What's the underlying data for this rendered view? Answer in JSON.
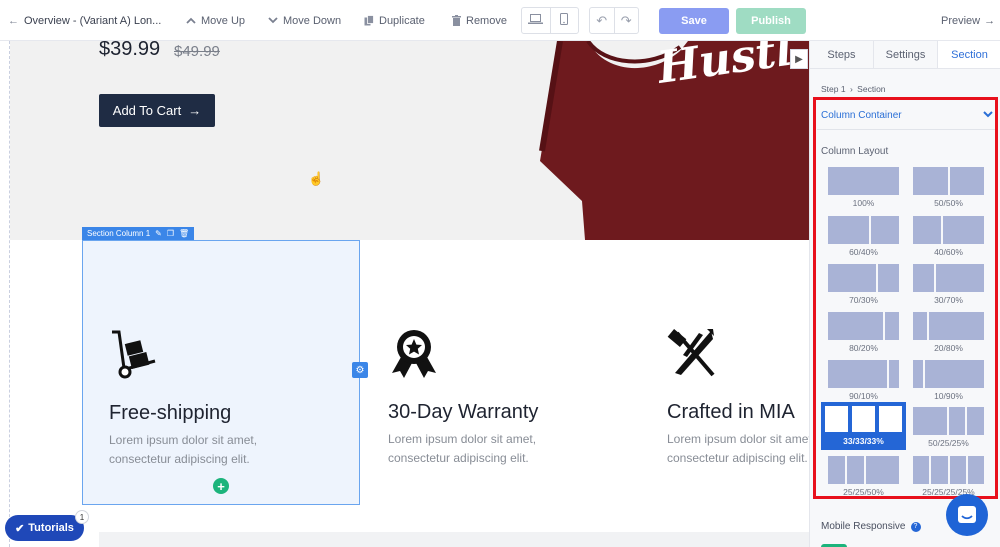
{
  "toolbar": {
    "overview_label": "Overview - (Variant A) Lon...",
    "move_up": "Move Up",
    "move_down": "Move Down",
    "duplicate": "Duplicate",
    "remove": "Remove",
    "save": "Save",
    "publish": "Publish",
    "preview": "Preview"
  },
  "hero": {
    "price": "$39.99",
    "old_price": "$49.99",
    "add_to_cart": "Add To Cart",
    "shirt_text": "Hustl"
  },
  "features": {
    "column_tag": "Section Column 1",
    "items": [
      {
        "title": "Free-shipping",
        "line1": "Lorem ipsum dolor sit amet,",
        "line2": "consectetur adipiscing elit."
      },
      {
        "title": "30-Day Warranty",
        "line1": "Lorem ipsum dolor sit amet,",
        "line2": "consectetur adipiscing elit."
      },
      {
        "title": "Crafted in MIA",
        "line1": "Lorem ipsum dolor sit amet,",
        "line2": "consectetur adipiscing elit."
      }
    ]
  },
  "tutorials": {
    "label": "Tutorials",
    "badge": "1"
  },
  "panel": {
    "tabs": [
      "Steps",
      "Settings",
      "Section"
    ],
    "active_tab": "Section",
    "breadcrumb_step": "Step 1",
    "breadcrumb_section": "Section",
    "container_label": "Column Container",
    "column_layout_label": "Column Layout",
    "layouts": [
      {
        "label": "100%"
      },
      {
        "label": "50/50%"
      },
      {
        "label": "60/40%"
      },
      {
        "label": "40/60%"
      },
      {
        "label": "70/30%"
      },
      {
        "label": "30/70%"
      },
      {
        "label": "80/20%"
      },
      {
        "label": "20/80%"
      },
      {
        "label": "90/10%"
      },
      {
        "label": "10/90%"
      },
      {
        "label": "33/33/33%",
        "selected": true
      },
      {
        "label": "50/25/25%"
      },
      {
        "label": "25/25/50%"
      },
      {
        "label": "25/25/25/25%"
      }
    ],
    "mobile_responsive": "Mobile Responsive",
    "mobile_responsive_on": true
  },
  "colors": {
    "accent": "#2466d6",
    "save": "#8a9cf2",
    "publish": "#9fdcc3",
    "highlight": "#e8101c",
    "cart_button": "#1f2c44",
    "shirt": "#6e1a1e"
  }
}
